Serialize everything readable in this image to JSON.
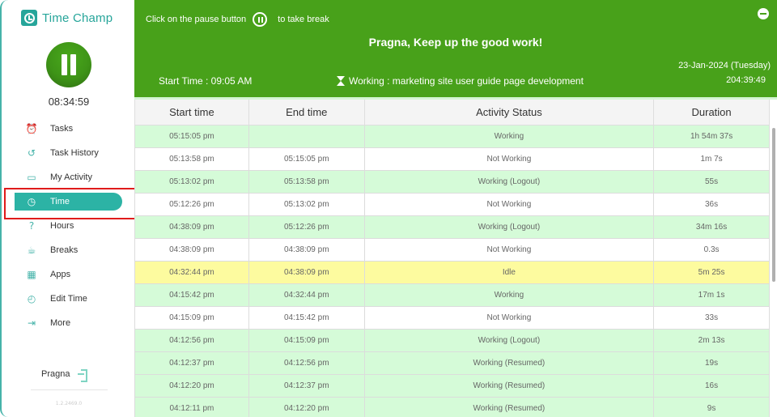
{
  "app": {
    "name": "Time Champ"
  },
  "sidebar": {
    "timer": "08:34:59",
    "items": [
      {
        "label": "Tasks",
        "icon": "alarm-clock-icon",
        "glyph": "⏰",
        "active": false
      },
      {
        "label": "Task History",
        "icon": "history-icon",
        "glyph": "↺",
        "active": false
      },
      {
        "label": "My Activity",
        "icon": "ticket-icon",
        "glyph": "▭",
        "active": false
      },
      {
        "label": "Time",
        "icon": "clock-icon",
        "glyph": "◷",
        "active": true
      },
      {
        "label": "Hours",
        "icon": "question-circle-icon",
        "glyph": "?",
        "active": false
      },
      {
        "label": "Breaks",
        "icon": "coffee-cup-icon",
        "glyph": "☕",
        "active": false
      },
      {
        "label": "Apps",
        "icon": "apps-grid-icon",
        "glyph": "▦",
        "active": false
      },
      {
        "label": "Edit Time",
        "icon": "edit-time-icon",
        "glyph": "◴",
        "active": false
      },
      {
        "label": "More",
        "icon": "more-icon",
        "glyph": "⇥",
        "active": false
      }
    ],
    "user_name": "Pragna",
    "version": "1.2.2469.0"
  },
  "header": {
    "hint_before": "Click on the pause button",
    "hint_after": "to take break",
    "greeting": "Pragna, Keep up the good work!",
    "start_time": "Start Time : 09:05 AM",
    "working": "Working : marketing site user guide page development",
    "date": "23-Jan-2024 (Tuesday)",
    "total_time": "204:39:49",
    "colors": {
      "header_bg": "#48a11a",
      "accent": "#2cb3a5"
    }
  },
  "table": {
    "columns": [
      "Start time",
      "End time",
      "Activity Status",
      "Duration"
    ],
    "rows": [
      {
        "start": "05:15:05 pm",
        "end": "",
        "status": "Working",
        "duration": "1h 54m 37s",
        "type": "working"
      },
      {
        "start": "05:13:58 pm",
        "end": "05:15:05 pm",
        "status": "Not Working",
        "duration": "1m 7s",
        "type": "notworking"
      },
      {
        "start": "05:13:02 pm",
        "end": "05:13:58 pm",
        "status": "Working (Logout)",
        "duration": "55s",
        "type": "working"
      },
      {
        "start": "05:12:26 pm",
        "end": "05:13:02 pm",
        "status": "Not Working",
        "duration": "36s",
        "type": "notworking"
      },
      {
        "start": "04:38:09 pm",
        "end": "05:12:26 pm",
        "status": "Working (Logout)",
        "duration": "34m 16s",
        "type": "working"
      },
      {
        "start": "04:38:09 pm",
        "end": "04:38:09 pm",
        "status": "Not Working",
        "duration": "0.3s",
        "type": "notworking"
      },
      {
        "start": "04:32:44 pm",
        "end": "04:38:09 pm",
        "status": "Idle",
        "duration": "5m 25s",
        "type": "idle"
      },
      {
        "start": "04:15:42 pm",
        "end": "04:32:44 pm",
        "status": "Working",
        "duration": "17m 1s",
        "type": "working"
      },
      {
        "start": "04:15:09 pm",
        "end": "04:15:42 pm",
        "status": "Not Working",
        "duration": "33s",
        "type": "notworking"
      },
      {
        "start": "04:12:56 pm",
        "end": "04:15:09 pm",
        "status": "Working (Logout)",
        "duration": "2m 13s",
        "type": "working"
      },
      {
        "start": "04:12:37 pm",
        "end": "04:12:56 pm",
        "status": "Working (Resumed)",
        "duration": "19s",
        "type": "working"
      },
      {
        "start": "04:12:20 pm",
        "end": "04:12:37 pm",
        "status": "Working (Resumed)",
        "duration": "16s",
        "type": "working"
      },
      {
        "start": "04:12:11 pm",
        "end": "04:12:20 pm",
        "status": "Working (Resumed)",
        "duration": "9s",
        "type": "working"
      }
    ]
  }
}
